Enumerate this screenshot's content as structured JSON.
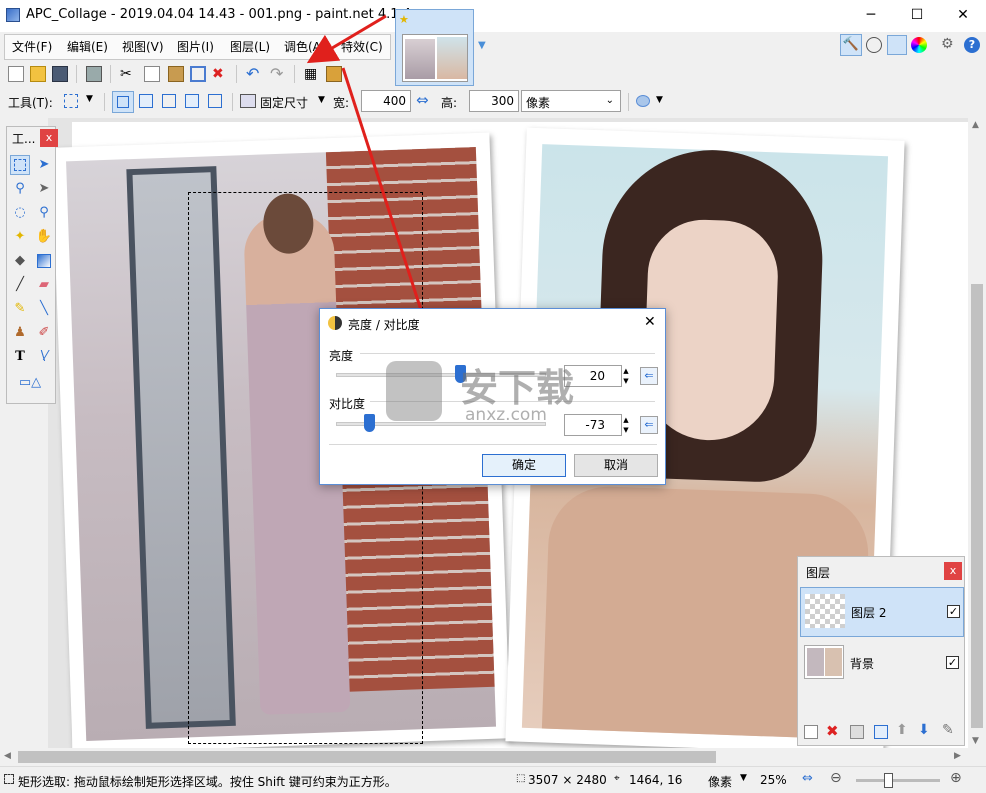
{
  "window": {
    "title": "APC_Collage - 2019.04.04 14.43 - 001.png - paint.net 4.1.4",
    "minimize": "─",
    "maximize": "☐",
    "close": "✕"
  },
  "menu": {
    "items": [
      "文件(F)",
      "编辑(E)",
      "视图(V)",
      "图片(I)",
      "图层(L)",
      "调色(A)",
      "特效(C)"
    ]
  },
  "toolbar": {
    "tool_label": "工具(T):",
    "fixed_size_label": "固定尺寸",
    "width_label": "宽:",
    "width_value": "400",
    "height_label": "高:",
    "height_value": "300",
    "unit_value": "像素"
  },
  "tools_panel": {
    "title": "工...",
    "close": "x"
  },
  "dialog": {
    "title": "亮度 / 对比度",
    "close": "✕",
    "brightness_label": "亮度",
    "brightness_value": "20",
    "brightness_fraction": 0.6,
    "contrast_label": "对比度",
    "contrast_value": "-73",
    "contrast_fraction": 0.135,
    "ok_label": "确定",
    "cancel_label": "取消"
  },
  "watermark": {
    "cn": "安下载",
    "en": "anxz.com"
  },
  "layers_panel": {
    "title": "图层",
    "close": "x",
    "layers": [
      {
        "name": "图层 2",
        "checked": "✓"
      },
      {
        "name": "背景",
        "checked": "✓"
      }
    ]
  },
  "status": {
    "hint": "矩形选取: 拖动鼠标绘制矩形选择区域。按住 Shift 键可约束为正方形。",
    "image_size": "3507 × 2480",
    "cursor_pos": "1464, 16",
    "unit": "像素",
    "zoom": "25%"
  },
  "colors": {
    "accent": "#cfe3f8",
    "arrow": "#e0201c",
    "close_red": "#e04343"
  }
}
